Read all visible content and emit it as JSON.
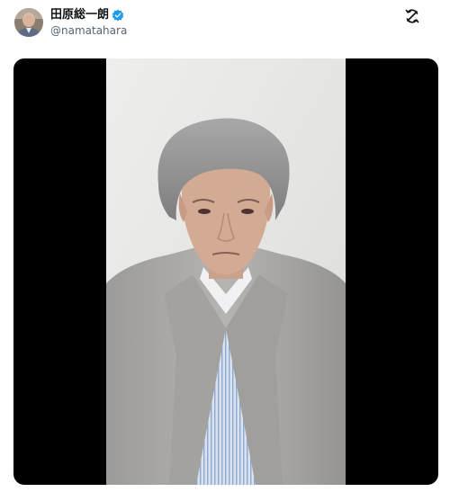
{
  "post": {
    "author": {
      "display_name": "田原総一朗",
      "handle": "@namatahara",
      "verified": true,
      "verified_color": "#1d9bf0"
    },
    "header_action_icon": "refresh-icon",
    "media": {
      "type": "video",
      "background_color": "#000000"
    }
  }
}
